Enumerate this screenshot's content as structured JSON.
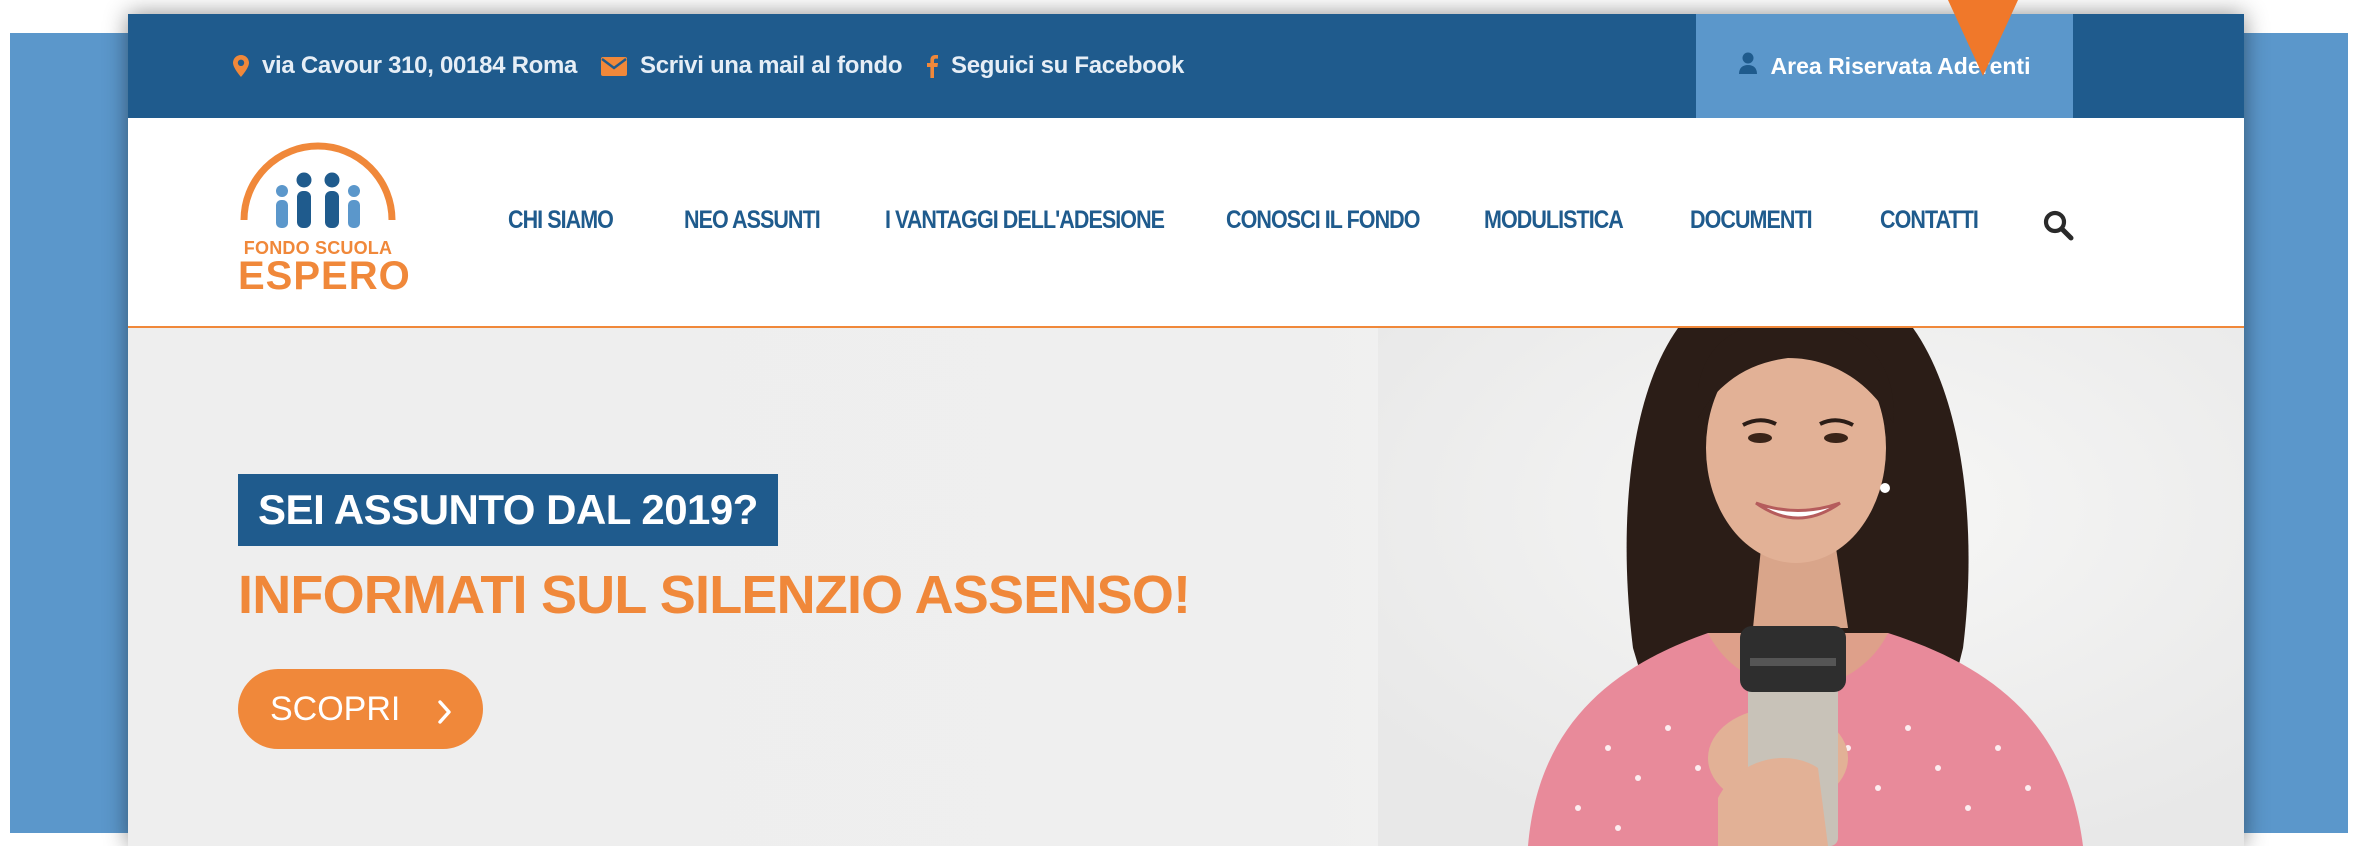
{
  "topbar": {
    "address": "via Cavour 310, 00184 Roma",
    "email_link": "Scrivi una mail al fondo",
    "facebook_link": "Seguici su Facebook",
    "area_button": "Area Riservata Aderenti"
  },
  "logo": {
    "line1": "FONDO SCUOLA",
    "line2": "ESPERO"
  },
  "nav": {
    "items": [
      "CHI SIAMO",
      "NEO ASSUNTI",
      "I VANTAGGI DELL'ADESIONE",
      "CONOSCI IL FONDO",
      "MODULISTICA",
      "DOCUMENTI",
      "CONTATTI"
    ]
  },
  "hero": {
    "tag": "SEI ASSUNTO DAL 2019?",
    "title": "INFORMATI SUL SILENZIO ASSENSO!",
    "cta": "SCOPRI"
  },
  "colors": {
    "brand_blue": "#1f5b8d",
    "light_blue": "#5b97cb",
    "brand_orange": "#f0883a"
  },
  "icons": [
    "map-pin-icon",
    "envelope-icon",
    "facebook-icon",
    "user-icon",
    "search-icon",
    "chevron-right-icon",
    "cursor-pointer-icon"
  ]
}
